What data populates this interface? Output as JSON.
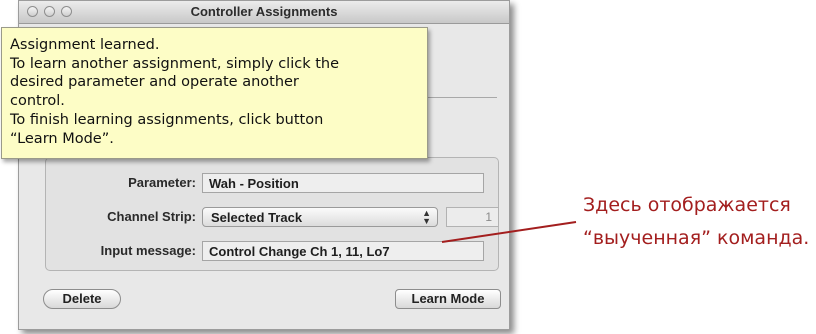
{
  "window": {
    "title": "Controller Assignments"
  },
  "tooltip": {
    "lines": [
      "Assignment learned.",
      "To learn another assignment, simply click the",
      "desired parameter and operate another",
      "control.",
      "To finish learning assignments, click button",
      "“Learn Mode”."
    ]
  },
  "form": {
    "parameter_label": "Parameter:",
    "parameter_value": "Wah - Position",
    "channel_strip_label": "Channel Strip:",
    "channel_strip_value": "Selected Track",
    "channel_number": "1",
    "input_message_label": "Input message:",
    "input_message_value": "Control Change Ch 1, 11, Lo7"
  },
  "buttons": {
    "delete": "Delete",
    "learn_mode": "Learn Mode"
  },
  "annotation": {
    "line1": "Здесь отображается",
    "line2": "“выученная” команда."
  },
  "colors": {
    "tooltip_bg": "#fdfdc6",
    "annotation": "#a31e1e"
  }
}
